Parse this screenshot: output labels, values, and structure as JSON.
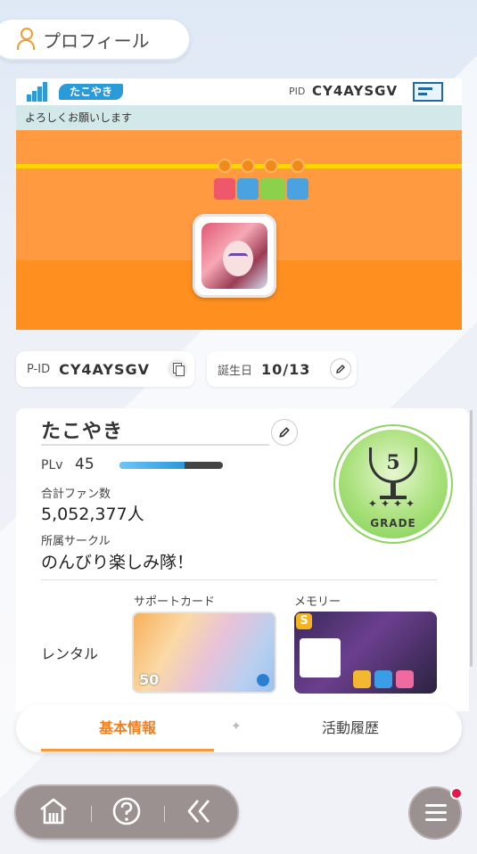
{
  "header": {
    "title": "プロフィール"
  },
  "card": {
    "name_tag": "たこやき",
    "pid_label": "PID",
    "pid_value": "CY4AYSGV",
    "comment": "よろしくお願いします"
  },
  "chips": {
    "pid_label": "P-ID",
    "pid_value": "CY4AYSGV",
    "birthday_label": "誕生日",
    "birthday_value": "10/13"
  },
  "profile": {
    "name": "たこやき",
    "plv_label": "PLv",
    "plv_value": "45",
    "plv_progress": 0.63,
    "fans_label": "合計ファン数",
    "fans_value": "5,052,377人",
    "circle_label": "所属サークル",
    "circle_value": "のんびり楽しみ隊！",
    "grade_number": "5",
    "grade_label": "GRADE",
    "rental_label": "レンタル",
    "support_label": "サポートカード",
    "memory_label": "メモリー",
    "support_level": "50",
    "memory_rank": "S"
  },
  "tabs": [
    {
      "label": "基本情報",
      "active": true
    },
    {
      "label": "活動履歴",
      "active": false
    }
  ],
  "colors": {
    "accent": "#f07f1f",
    "card_orange": "#ff9b3a",
    "name_tag_blue": "#2a9ad8",
    "grade_green": "#7ccf52",
    "notification": "#e8174a"
  },
  "icons": [
    "person-icon",
    "bars-icon",
    "card-icon",
    "copy-icon",
    "edit-icon",
    "home-icon",
    "help-icon",
    "back-icon",
    "menu-icon"
  ]
}
